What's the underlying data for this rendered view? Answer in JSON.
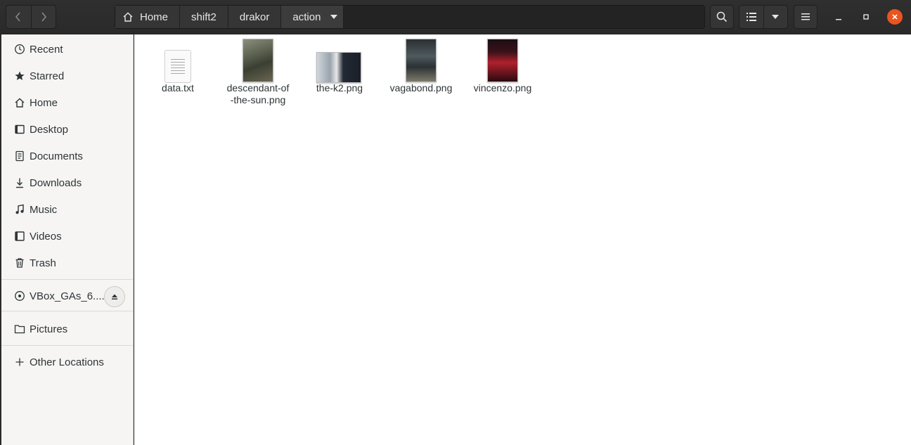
{
  "breadcrumbs": [
    {
      "label": "Home"
    },
    {
      "label": "shift2"
    },
    {
      "label": "drakor"
    },
    {
      "label": "action"
    }
  ],
  "sidebar": {
    "places": [
      {
        "label": "Recent",
        "icon": "clock-icon"
      },
      {
        "label": "Starred",
        "icon": "star-icon"
      },
      {
        "label": "Home",
        "icon": "home-icon"
      },
      {
        "label": "Desktop",
        "icon": "desktop-icon"
      },
      {
        "label": "Documents",
        "icon": "document-icon"
      },
      {
        "label": "Downloads",
        "icon": "download-icon"
      },
      {
        "label": "Music",
        "icon": "music-icon"
      },
      {
        "label": "Videos",
        "icon": "video-icon"
      },
      {
        "label": "Trash",
        "icon": "trash-icon"
      }
    ],
    "devices": [
      {
        "label": "VBox_GAs_6....",
        "icon": "disc-icon"
      }
    ],
    "bookmarks": [
      {
        "label": "Pictures",
        "icon": "folder-icon"
      }
    ],
    "other": {
      "label": "Other Locations",
      "icon": "plus-icon"
    }
  },
  "files": [
    {
      "name": "data.txt",
      "type": "text"
    },
    {
      "name": "descendant-of-the-sun.png",
      "type": "image"
    },
    {
      "name": "the-k2.png",
      "type": "image"
    },
    {
      "name": "vagabond.png",
      "type": "image"
    },
    {
      "name": "vincenzo.png",
      "type": "image"
    }
  ],
  "colors": {
    "accent": "#e95420",
    "headerbar": "#2c2c2c",
    "sidebar": "#f6f5f4",
    "content": "#ffffff"
  }
}
